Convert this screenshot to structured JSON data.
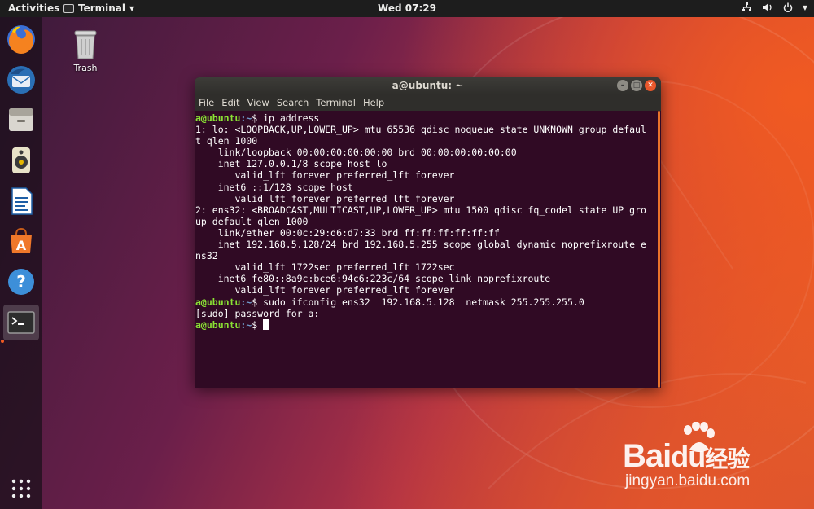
{
  "topbar": {
    "activities": "Activities",
    "app_menu": "Terminal",
    "clock": "Wed 07:29"
  },
  "icons": {
    "network": "network-icon",
    "volume": "volume-icon",
    "power": "power-icon"
  },
  "dock": {
    "items": [
      "Firefox",
      "Thunderbird",
      "Files",
      "Rhythmbox",
      "LibreOffice Writer",
      "Ubuntu Software",
      "Help",
      "Terminal"
    ],
    "active": "Terminal",
    "accent": "#f05a22"
  },
  "desktop": {
    "trash_label": "Trash"
  },
  "terminal": {
    "title": "a@ubuntu: ~",
    "menu": [
      "File",
      "Edit",
      "View",
      "Search",
      "Terminal",
      "Help"
    ],
    "prompt_user": "a@ubuntu",
    "prompt_path": ":~",
    "prompt_symbol": "$",
    "lines": [
      {
        "type": "cmd",
        "text": " ip address"
      },
      {
        "type": "out",
        "text": "1: lo: <LOOPBACK,UP,LOWER_UP> mtu 65536 qdisc noqueue state UNKNOWN group defaul"
      },
      {
        "type": "out",
        "text": "t qlen 1000"
      },
      {
        "type": "out",
        "text": "    link/loopback 00:00:00:00:00:00 brd 00:00:00:00:00:00"
      },
      {
        "type": "out",
        "text": "    inet 127.0.0.1/8 scope host lo"
      },
      {
        "type": "out",
        "text": "       valid_lft forever preferred_lft forever"
      },
      {
        "type": "out",
        "text": "    inet6 ::1/128 scope host"
      },
      {
        "type": "out",
        "text": "       valid_lft forever preferred_lft forever"
      },
      {
        "type": "out",
        "text": "2: ens32: <BROADCAST,MULTICAST,UP,LOWER_UP> mtu 1500 qdisc fq_codel state UP gro"
      },
      {
        "type": "out",
        "text": "up default qlen 1000"
      },
      {
        "type": "out",
        "text": "    link/ether 00:0c:29:d6:d7:33 brd ff:ff:ff:ff:ff:ff"
      },
      {
        "type": "out",
        "text": "    inet 192.168.5.128/24 brd 192.168.5.255 scope global dynamic noprefixroute e"
      },
      {
        "type": "out",
        "text": "ns32"
      },
      {
        "type": "out",
        "text": "       valid_lft 1722sec preferred_lft 1722sec"
      },
      {
        "type": "out",
        "text": "    inet6 fe80::8a9c:bce6:94c6:223c/64 scope link noprefixroute"
      },
      {
        "type": "out",
        "text": "       valid_lft forever preferred_lft forever"
      },
      {
        "type": "cmd",
        "text": " sudo ifconfig ens32  192.168.5.128  netmask 255.255.255.0"
      },
      {
        "type": "out",
        "text": "[sudo] password for a:"
      },
      {
        "type": "cmd",
        "text": " ",
        "cursor": true
      }
    ],
    "colors": {
      "background": "#300a24",
      "user": "#8ae234",
      "path": "#729fcf",
      "text": "#ffffff"
    }
  },
  "watermark": {
    "brand": "Bai",
    "brand_cn": "经验",
    "url": "jingyan.baidu.com"
  }
}
